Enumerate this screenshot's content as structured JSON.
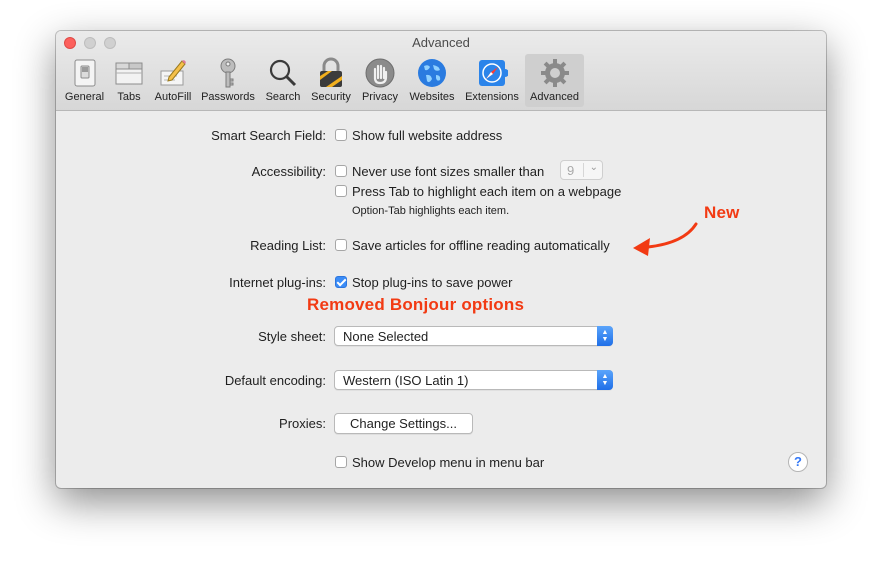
{
  "window": {
    "title": "Advanced"
  },
  "toolbar": {
    "tabs": [
      {
        "label": "General",
        "icon": "general-switch-icon"
      },
      {
        "label": "Tabs",
        "icon": "tabs-icon"
      },
      {
        "label": "AutoFill",
        "icon": "autofill-pencil-icon"
      },
      {
        "label": "Passwords",
        "icon": "key-icon"
      },
      {
        "label": "Search",
        "icon": "magnifier-icon"
      },
      {
        "label": "Security",
        "icon": "lock-icon"
      },
      {
        "label": "Privacy",
        "icon": "hand-icon"
      },
      {
        "label": "Websites",
        "icon": "globe-icon"
      },
      {
        "label": "Extensions",
        "icon": "puzzle-compass-icon"
      },
      {
        "label": "Advanced",
        "icon": "gear-icon"
      }
    ],
    "active": "Advanced"
  },
  "settings": {
    "smart_search": {
      "label": "Smart Search Field:",
      "option": "Show full website address",
      "checked": false
    },
    "accessibility": {
      "label": "Accessibility:",
      "option1": "Never use font sizes smaller than",
      "option1_checked": false,
      "font_size_value": "9",
      "option2": "Press Tab to highlight each item on a webpage",
      "option2_checked": false,
      "note": "Option-Tab highlights each item."
    },
    "reading_list": {
      "label": "Reading List:",
      "option": "Save articles for offline reading automatically",
      "checked": false
    },
    "plugins": {
      "label": "Internet plug-ins:",
      "option": "Stop plug-ins to save power",
      "checked": true
    },
    "style_sheet": {
      "label": "Style sheet:",
      "value": "None Selected"
    },
    "encoding": {
      "label": "Default encoding:",
      "value": "Western (ISO Latin 1)"
    },
    "proxies": {
      "label": "Proxies:",
      "button": "Change Settings..."
    },
    "develop_menu": {
      "option": "Show Develop menu in menu bar",
      "checked": false
    },
    "help": "?"
  },
  "annotations": {
    "new": "New",
    "removed": "Removed Bonjour options",
    "color": "#f23a13"
  },
  "colors": {
    "accent": "#3a8cf7",
    "close": "#fc605c"
  }
}
